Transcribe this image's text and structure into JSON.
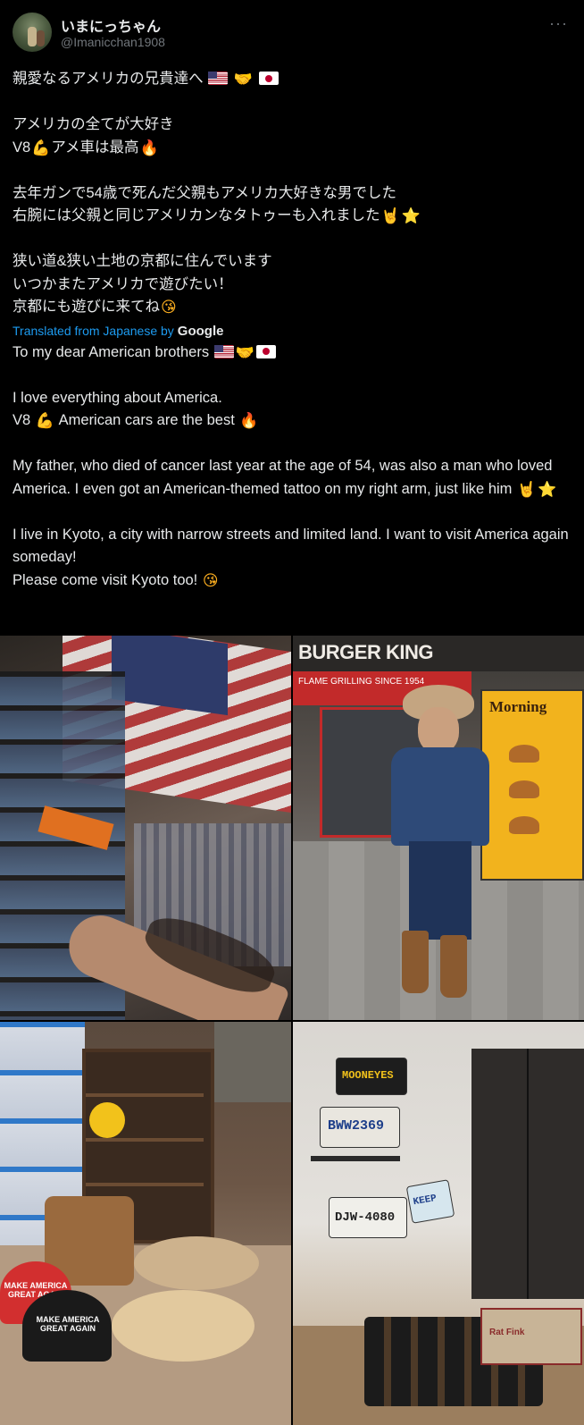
{
  "post": {
    "display_name": "いまにっちゃん",
    "handle": "@Imanicchan1908",
    "more_label": "···"
  },
  "original_text": {
    "l1": "親愛なるアメリカの兄貴達へ",
    "l2": "アメリカの全てが大好き",
    "l3a": "V8",
    "l3b": "アメ車は最高",
    "l4": "去年ガンで54歳で死んだ父親もアメリカ大好きな男でした",
    "l5": "右腕には父親と同じアメリカンなタトゥーも入れました",
    "l6": "狭い道&狭い土地の京都に住んでいます",
    "l7": "いつかまたアメリカで遊びたい！",
    "l8": "京都にも遊びに来てね"
  },
  "translation": {
    "label": "Translated from Japanese by",
    "provider": "Google",
    "l1": "To my dear American brothers",
    "l2": "I love everything about America.",
    "l3a": "V8",
    "l3b": "American cars are the best",
    "l4": "My father, who died of cancer last year at the age of 54, was also a man who loved America. I even got an American-themed tattoo on my right arm, just like him",
    "l5": "I live in Kyoto, a city with narrow streets and limited land. I want to visit America again someday!",
    "l6": "Please come visit Kyoto too!"
  },
  "emoji": {
    "flag_us": "flag-us-icon",
    "handshake": "🤝",
    "flag_jp": "flag-jp-icon",
    "muscle": "💪",
    "fire": "🔥",
    "rock": "🤘",
    "star": "⭐",
    "kiss": "😘"
  },
  "photos": {
    "p2_sign": "BURGER KING",
    "p2_banner": "FLAME GRILLING SINCE 1954",
    "p2_poster_title": "Morning",
    "p3_cap_red": "MAKE AMERICA GREAT AGAIN",
    "p3_cap_black": "MAKE AMERICA GREAT AGAIN",
    "p4_plate_mooneyes": "MOONEYES",
    "p4_plate_calif": "BWW2369",
    "p4_plate_texas": "DJW-4080",
    "p4_plate_small": "KEEP",
    "p4_mat_text": "Rat Fink"
  },
  "colors": {
    "background": "#000000",
    "text": "#e7e9ea",
    "muted": "#71767b",
    "link": "#1d9bf0"
  }
}
